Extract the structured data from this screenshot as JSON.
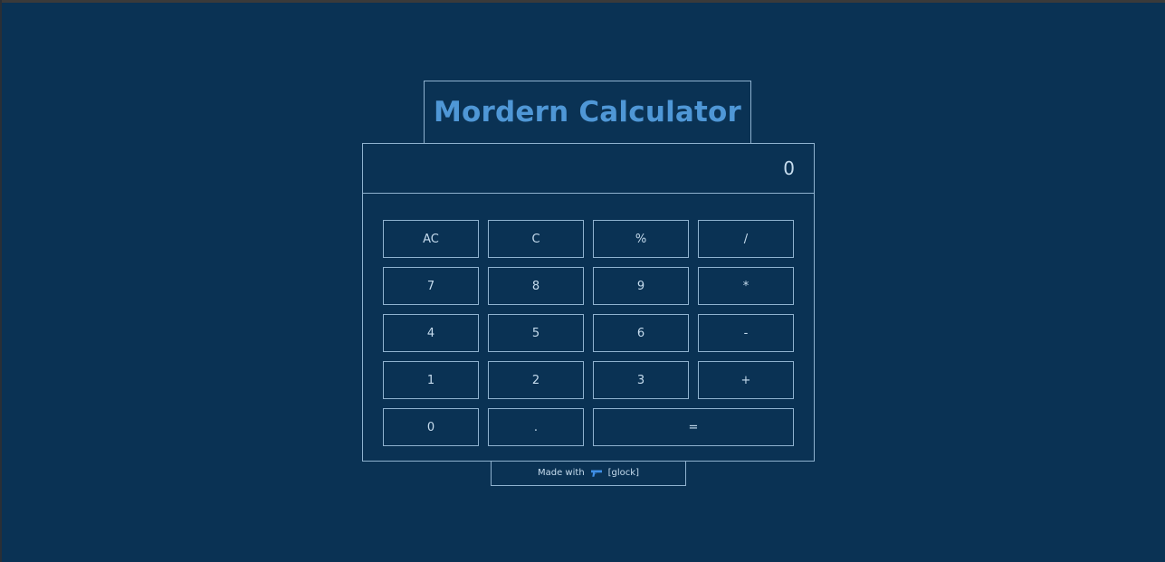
{
  "app": {
    "title": "Mordern Calculator"
  },
  "display": {
    "value": "0"
  },
  "keypad": {
    "keys": [
      {
        "label": "AC",
        "name": "key-all-clear"
      },
      {
        "label": "C",
        "name": "key-clear"
      },
      {
        "label": "%",
        "name": "key-percent"
      },
      {
        "label": "/",
        "name": "key-divide"
      },
      {
        "label": "7",
        "name": "key-7"
      },
      {
        "label": "8",
        "name": "key-8"
      },
      {
        "label": "9",
        "name": "key-9"
      },
      {
        "label": "*",
        "name": "key-multiply"
      },
      {
        "label": "4",
        "name": "key-4"
      },
      {
        "label": "5",
        "name": "key-5"
      },
      {
        "label": "6",
        "name": "key-6"
      },
      {
        "label": "-",
        "name": "key-subtract"
      },
      {
        "label": "1",
        "name": "key-1"
      },
      {
        "label": "2",
        "name": "key-2"
      },
      {
        "label": "3",
        "name": "key-3"
      },
      {
        "label": "+",
        "name": "key-add"
      },
      {
        "label": "0",
        "name": "key-0"
      },
      {
        "label": ".",
        "name": "key-decimal"
      },
      {
        "label": "=",
        "name": "key-equals"
      }
    ]
  },
  "footer": {
    "made_with": "Made with",
    "icon": "pistol-icon",
    "author": "[glock]"
  },
  "colors": {
    "background": "#0a3254",
    "title": "#4f97d6",
    "border": "#8fb2cf",
    "text": "#c6dcee",
    "icon": "#3f8fe6"
  }
}
